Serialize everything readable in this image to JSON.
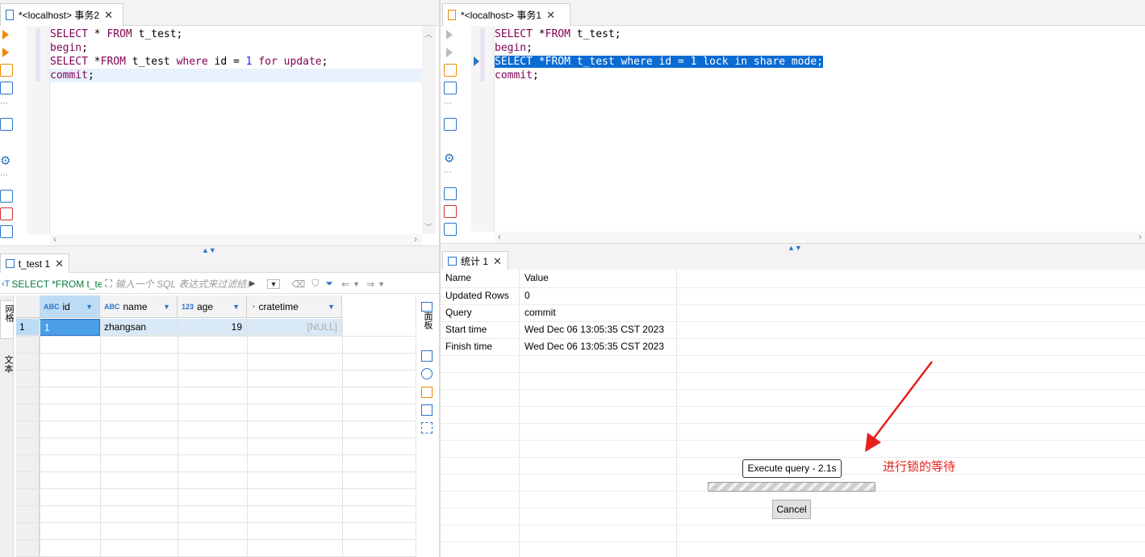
{
  "left_editor": {
    "tab_title": "*<localhost> 事务2",
    "lines": [
      [
        {
          "t": "SELECT",
          "c": "kw"
        },
        {
          "t": " * ",
          "c": "plain"
        },
        {
          "t": "FROM",
          "c": "kw"
        },
        {
          "t": " t_test;",
          "c": "plain"
        }
      ],
      [
        {
          "t": "begin",
          "c": "kw"
        },
        {
          "t": ";",
          "c": "plain"
        }
      ],
      [
        {
          "t": "SELECT",
          "c": "kw"
        },
        {
          "t": " *",
          "c": "plain"
        },
        {
          "t": "FROM",
          "c": "kw"
        },
        {
          "t": " t_test ",
          "c": "plain"
        },
        {
          "t": "where",
          "c": "kw"
        },
        {
          "t": " id = ",
          "c": "plain"
        },
        {
          "t": "1",
          "c": "num"
        },
        {
          "t": " ",
          "c": "plain"
        },
        {
          "t": "for",
          "c": "kw"
        },
        {
          "t": " ",
          "c": "plain"
        },
        {
          "t": "update",
          "c": "kw"
        },
        {
          "t": ";",
          "c": "plain"
        }
      ],
      [
        {
          "t": "commit",
          "c": "kw"
        },
        {
          "t": ";",
          "c": "plain"
        }
      ]
    ]
  },
  "right_editor": {
    "tab_title": "*<localhost> 事务1",
    "lines": [
      [
        {
          "t": "SELECT",
          "c": "kw"
        },
        {
          "t": " *",
          "c": "plain"
        },
        {
          "t": "FROM",
          "c": "kw"
        },
        {
          "t": " t_test;",
          "c": "plain"
        }
      ],
      [
        {
          "t": "begin",
          "c": "kw"
        },
        {
          "t": ";",
          "c": "plain"
        }
      ],
      [
        {
          "t": "SELECT *FROM t_test where id = 1 lock in share mode;",
          "c": "sel"
        }
      ],
      [
        {
          "t": "commit",
          "c": "kw"
        },
        {
          "t": ";",
          "c": "plain"
        }
      ]
    ]
  },
  "results": {
    "tab_title": "t_test 1",
    "filter_sql": "SELECT *FROM t_te",
    "filter_placeholder": "输入一个 SQL 表达式来过滤结果",
    "side_tabs": [
      "网格",
      "文本"
    ],
    "right_side_label": "面板",
    "columns": [
      {
        "type": "ABC",
        "name": "id"
      },
      {
        "type": "ABC",
        "name": "name"
      },
      {
        "type": "123",
        "name": "age"
      },
      {
        "type": "clock",
        "name": "cratetime"
      }
    ],
    "rows": [
      {
        "num": "1",
        "cells": [
          "1",
          "zhangsan",
          "19",
          "[NULL]"
        ]
      }
    ]
  },
  "stats": {
    "tab_title": "统计 1",
    "header": [
      "Name",
      "Value"
    ],
    "rows": [
      [
        "Updated Rows",
        "0"
      ],
      [
        "Query",
        "commit"
      ],
      [
        "Start time",
        "Wed Dec 06 13:05:35 CST 2023"
      ],
      [
        "Finish time",
        "Wed Dec 06 13:05:35 CST 2023"
      ]
    ],
    "execute_label": "Execute query - 2.1s",
    "cancel_label": "Cancel",
    "annotation": "进行锁的等待"
  },
  "colors": {
    "accent": "#2a74c7",
    "selection": "#0a6bd3",
    "arrow": "#e8201a"
  }
}
